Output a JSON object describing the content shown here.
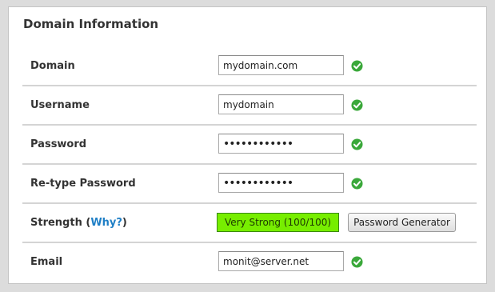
{
  "panel": {
    "title": "Domain Information"
  },
  "fields": {
    "domain": {
      "label": "Domain",
      "value": "mydomain.com"
    },
    "username": {
      "label": "Username",
      "value": "mydomain"
    },
    "password": {
      "label": "Password",
      "value": "••••••••••••"
    },
    "retype": {
      "label": "Re-type Password",
      "value": "••••••••••••"
    },
    "strength": {
      "label": "Strength (",
      "link": "Why?",
      "label_end": ")",
      "value": "Very Strong (100/100)",
      "score": 100,
      "generator_label": "Password Generator"
    },
    "email": {
      "label": "Email",
      "value": "monit@server.net"
    }
  },
  "colors": {
    "check": "#3aa83a",
    "strength_bg": "#77ee00",
    "link": "#1f7fc6"
  },
  "icons": {
    "valid": "check-circle-icon"
  }
}
